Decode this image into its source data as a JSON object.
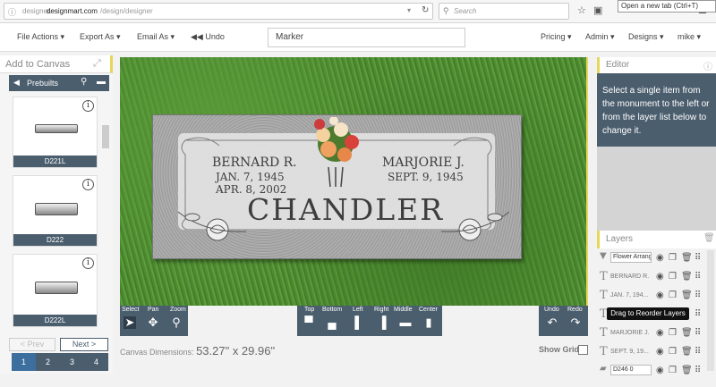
{
  "browser": {
    "url_prefix": "designer.",
    "url_domain": "designmart.com",
    "url_path": "/design/designer",
    "search_placeholder": "Search",
    "new_tab_tooltip": "Open a new tab (Ctrl+T)"
  },
  "appbar": {
    "file_actions": "File Actions",
    "export_as": "Export As",
    "email_as": "Email As",
    "undo": "Undo",
    "marker": "Marker",
    "pricing": "Pricing",
    "admin": "Admin",
    "designs": "Designs",
    "user": "mike"
  },
  "left": {
    "title": "Add to Canvas",
    "prebuilts": "Prebuilts",
    "tiles": [
      "D221L",
      "D222",
      "D222L"
    ],
    "prev": "< Prev",
    "next": "Next >",
    "pages": [
      "1",
      "2",
      "3",
      "4"
    ]
  },
  "monument": {
    "left_name": "BERNARD R.",
    "left_birth": "JAN. 7, 1945",
    "left_death": "APR. 8, 2002",
    "right_name": "MARJORIE J.",
    "right_birth": "SEPT. 9, 1945",
    "surname": "CHANDLER"
  },
  "toolbar": {
    "select": "Select",
    "pan": "Pan",
    "zoom": "Zoom",
    "top": "Top",
    "bottom": "Bottom",
    "left": "Left",
    "right": "Right",
    "middle": "Middle",
    "center": "Center",
    "undo": "Undo",
    "redo": "Redo"
  },
  "canvas_dims_label": "Canvas Dimensions:",
  "canvas_dims_value": "53.27\" x 29.96\"",
  "show_grid": "Show Grid",
  "editor": {
    "title": "Editor",
    "message": "Select a single item from the monument to the left or from the layer list below to change it."
  },
  "layers": {
    "title": "Layers",
    "items": [
      "Flower Arrang",
      "BERNARD R.",
      "JAN. 7, 194...",
      "",
      "MARJORIE J.",
      "SEPT. 9, 19...",
      "D246 0"
    ],
    "tooltip": "Drag to Reorder Layers"
  },
  "colors": {
    "panel": "#4b5e6e",
    "accent": "#e6d75a",
    "grass": "#4d8a30",
    "granite": "#a8a8a8"
  }
}
